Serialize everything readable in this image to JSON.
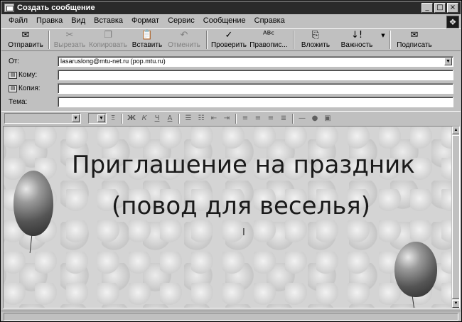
{
  "window": {
    "title": "Создать сообщение",
    "btn_min": "_",
    "btn_max": "□",
    "btn_close": "×"
  },
  "menu": [
    "Файл",
    "Правка",
    "Вид",
    "Вставка",
    "Формат",
    "Сервис",
    "Сообщение",
    "Справка"
  ],
  "toolbar": {
    "send": "Отправить",
    "cut": "Вырезать",
    "copy": "Копировать",
    "paste": "Вставить",
    "undo": "Отменить",
    "check": "Проверить",
    "spelling": "Правопис...",
    "attach": "Вложить",
    "priority": "Важность",
    "sign": "Подписать"
  },
  "header": {
    "from_label": "От:",
    "from_value": "lasaruslong@mtu-net.ru    (pop.mtu.ru)",
    "to_label": "Кому:",
    "cc_label": "Копия:",
    "subject_label": "Тема:"
  },
  "body": {
    "line1": "Приглашение на праздник",
    "line2": "(повод для веселья)",
    "cursor": "I"
  },
  "icons": [
    "send-icon",
    "cut-icon",
    "copy-icon",
    "paste-icon",
    "undo-icon",
    "check-icon",
    "spelling-icon",
    "attach-icon",
    "priority-icon",
    "sign-icon",
    "address-book-icon"
  ]
}
